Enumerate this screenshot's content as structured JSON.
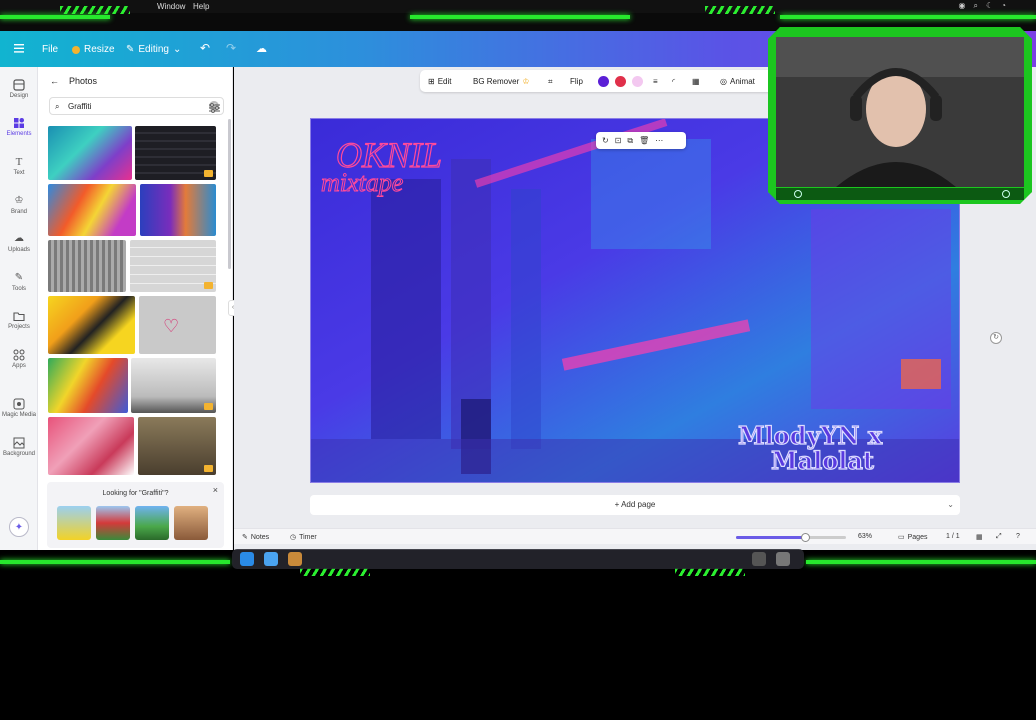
{
  "menubar": {
    "items": [
      "Window",
      "Help"
    ]
  },
  "header": {
    "file": "File",
    "resize": "Resize",
    "editing": "Editing"
  },
  "rail": {
    "items": [
      {
        "label": "Design",
        "icon": "layout-icon"
      },
      {
        "label": "Elements",
        "icon": "elements-icon"
      },
      {
        "label": "Text",
        "icon": "text-icon"
      },
      {
        "label": "Brand",
        "icon": "crown-icon"
      },
      {
        "label": "Uploads",
        "icon": "cloud-upload-icon"
      },
      {
        "label": "Tools",
        "icon": "pen-icon"
      },
      {
        "label": "Projects",
        "icon": "folder-icon"
      },
      {
        "label": "Apps",
        "icon": "apps-icon"
      },
      {
        "label": "Magic Media",
        "icon": "magic-media-icon"
      },
      {
        "label": "Background",
        "icon": "background-icon"
      }
    ]
  },
  "panel": {
    "title": "Photos",
    "search_value": "Graffiti",
    "looking_for": "Looking for \"Graffiti\"?"
  },
  "context_toolbar": {
    "edit": "Edit",
    "bg_remover": "BG Remover",
    "flip": "Flip",
    "animate": "Animat",
    "colors": [
      "#5b1fd6",
      "#e0304a",
      "#f3c8f0"
    ]
  },
  "canvas": {
    "title_line1": "OKNIL",
    "title_line2": "mixtape",
    "artist_line1": "MlodyYN x",
    "artist_line2": "Malolat"
  },
  "add_page": "+ Add page",
  "footer": {
    "notes": "Notes",
    "timer": "Timer",
    "zoom": "63%",
    "zoom_level": 0.63,
    "pages": "Pages",
    "page_count": "1 / 1"
  }
}
